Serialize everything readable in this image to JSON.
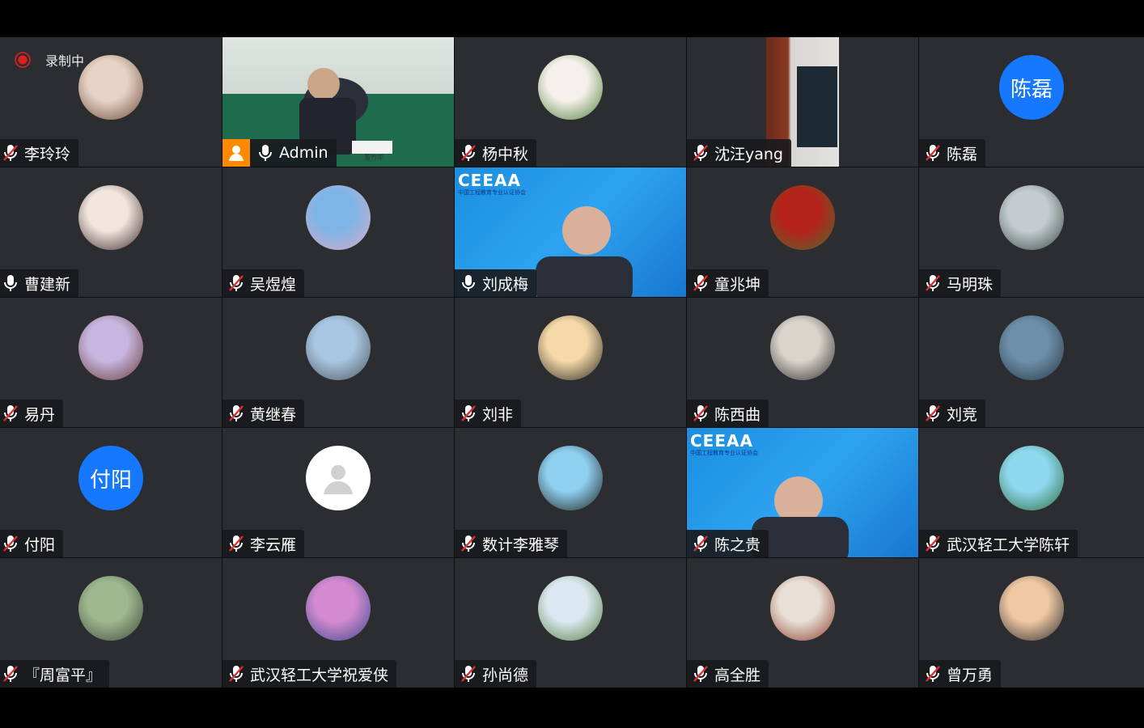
{
  "recording": {
    "label": "录制中"
  },
  "participants": [
    {
      "name": "李玲玲",
      "mic": "muted",
      "avatar": "photo",
      "colors": [
        "#e6d3c6",
        "#6d4b3a"
      ]
    },
    {
      "name": "Admin",
      "mic": "on",
      "avatar": "video-host",
      "host": true
    },
    {
      "name": "杨中秋",
      "mic": "muted",
      "avatar": "photo",
      "colors": [
        "#f6f0ec",
        "#4f7f3a"
      ]
    },
    {
      "name": "沈汪yang",
      "mic": "muted",
      "avatar": "video-room"
    },
    {
      "name": "陈磊",
      "mic": "muted",
      "avatar": "text",
      "avatar_text": "陈磊"
    },
    {
      "name": "曹建新",
      "mic": "on",
      "avatar": "photo",
      "colors": [
        "#f2e6df",
        "#3b2a2a"
      ]
    },
    {
      "name": "吴煜煌",
      "mic": "muted",
      "avatar": "photo",
      "colors": [
        "#7fb5e6",
        "#d9a9c9"
      ]
    },
    {
      "name": "刘成梅",
      "mic": "on",
      "avatar": "video-ceeaa"
    },
    {
      "name": "童兆坤",
      "mic": "muted",
      "avatar": "photo",
      "colors": [
        "#b5231b",
        "#4e6a2c"
      ]
    },
    {
      "name": "马明珠",
      "mic": "muted",
      "avatar": "photo",
      "colors": [
        "#c4ccd2",
        "#3c4940"
      ]
    },
    {
      "name": "易丹",
      "mic": "muted",
      "avatar": "photo",
      "colors": [
        "#c7b6df",
        "#6b3b3b"
      ]
    },
    {
      "name": "黄继春",
      "mic": "muted",
      "avatar": "photo",
      "colors": [
        "#a9c7e2",
        "#4e5560"
      ]
    },
    {
      "name": "刘非",
      "mic": "muted",
      "avatar": "photo",
      "colors": [
        "#f5d9a8",
        "#2a2723"
      ]
    },
    {
      "name": "陈西曲",
      "mic": "muted",
      "avatar": "photo",
      "colors": [
        "#d9d4cc",
        "#2e2b27"
      ]
    },
    {
      "name": "刘竞",
      "mic": "muted",
      "avatar": "photo",
      "colors": [
        "#6e8fa8",
        "#263845"
      ]
    },
    {
      "name": "付阳",
      "mic": "muted",
      "avatar": "text",
      "avatar_text": "付阳"
    },
    {
      "name": "李云雁",
      "mic": "muted",
      "avatar": "blank"
    },
    {
      "name": "数计李雅琴",
      "mic": "muted",
      "avatar": "photo",
      "colors": [
        "#8fd0f0",
        "#1f1f1f"
      ]
    },
    {
      "name": "陈之贵",
      "mic": "muted",
      "avatar": "video-ceeaa2"
    },
    {
      "name": "武汉轻工大学陈轩",
      "mic": "muted",
      "avatar": "photo",
      "colors": [
        "#8fd9f0",
        "#2d6b3a"
      ]
    },
    {
      "name": "『周富平』",
      "mic": "muted",
      "avatar": "photo",
      "colors": [
        "#9fb890",
        "#3d4a3a"
      ]
    },
    {
      "name": "武汉轻工大学祝爱侠",
      "mic": "muted",
      "avatar": "photo",
      "colors": [
        "#d48ad0",
        "#3a4a8a"
      ]
    },
    {
      "name": "孙尚德",
      "mic": "muted",
      "avatar": "photo",
      "colors": [
        "#dbe8f2",
        "#56803e"
      ]
    },
    {
      "name": "高全胜",
      "mic": "muted",
      "avatar": "photo",
      "colors": [
        "#e8e0d6",
        "#8b3a2a"
      ]
    },
    {
      "name": "曾万勇",
      "mic": "muted",
      "avatar": "photo",
      "colors": [
        "#efc8a4",
        "#2a2a2a"
      ]
    }
  ],
  "video": {
    "host_desk_sign": "董竹华",
    "ceeaa_logo": "CEEAA",
    "ceeaa_sub": "中国工程教育专业认证协会"
  }
}
